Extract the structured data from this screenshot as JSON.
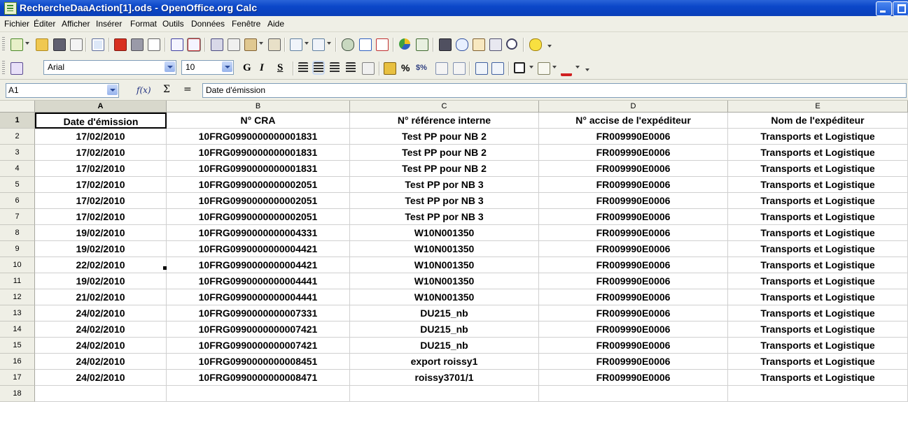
{
  "window": {
    "title": "RechercheDaaAction[1].ods - OpenOffice.org Calc"
  },
  "menu": [
    "Fichier",
    "Éditer",
    "Afficher",
    "Insérer",
    "Format",
    "Outils",
    "Données",
    "Fenêtre",
    "Aide"
  ],
  "format_toolbar": {
    "font_name": "Arial",
    "font_size": "10",
    "bold_label": "G",
    "italic_label": "I",
    "underline_label": "S",
    "percent_label": "%",
    "currency_label": "$%"
  },
  "formula_bar": {
    "cell_ref": "A1",
    "function_wizard": "f(x)",
    "sum_symbol": "Σ",
    "equals_symbol": "=",
    "content": "Date d'émission"
  },
  "sheet": {
    "columns": [
      "A",
      "B",
      "C",
      "D",
      "E"
    ],
    "headers": [
      "Date d'émission",
      "N° CRA",
      "N° référence interne",
      "N° accise de l'expéditeur",
      "Nom de l'expéditeur"
    ],
    "row_numbers": [
      "1",
      "2",
      "3",
      "4",
      "5",
      "6",
      "7",
      "8",
      "9",
      "10",
      "11",
      "12",
      "13",
      "14",
      "15",
      "16",
      "17",
      "18"
    ],
    "rows": [
      [
        "17/02/2010",
        "10FRG0990000000001831",
        "Test PP pour NB 2",
        "FR009990E0006",
        "Transports et Logistique"
      ],
      [
        "17/02/2010",
        "10FRG0990000000001831",
        "Test PP pour NB 2",
        "FR009990E0006",
        "Transports et Logistique"
      ],
      [
        "17/02/2010",
        "10FRG0990000000001831",
        "Test PP pour NB 2",
        "FR009990E0006",
        "Transports et Logistique"
      ],
      [
        "17/02/2010",
        "10FRG0990000000002051",
        "Test PP por NB 3",
        "FR009990E0006",
        "Transports et Logistique"
      ],
      [
        "17/02/2010",
        "10FRG0990000000002051",
        "Test PP por NB 3",
        "FR009990E0006",
        "Transports et Logistique"
      ],
      [
        "17/02/2010",
        "10FRG0990000000002051",
        "Test PP por NB 3",
        "FR009990E0006",
        "Transports et Logistique"
      ],
      [
        "19/02/2010",
        "10FRG0990000000004331",
        "W10N001350",
        "FR009990E0006",
        "Transports et Logistique"
      ],
      [
        "19/02/2010",
        "10FRG0990000000004421",
        "W10N001350",
        "FR009990E0006",
        "Transports et Logistique"
      ],
      [
        "22/02/2010",
        "10FRG0990000000004421",
        "W10N001350",
        "FR009990E0006",
        "Transports et Logistique"
      ],
      [
        "19/02/2010",
        "10FRG0990000000004441",
        "W10N001350",
        "FR009990E0006",
        "Transports et Logistique"
      ],
      [
        "21/02/2010",
        "10FRG0990000000004441",
        "W10N001350",
        "FR009990E0006",
        "Transports et Logistique"
      ],
      [
        "24/02/2010",
        "10FRG0990000000007331",
        "DU215_nb",
        "FR009990E0006",
        "Transports et Logistique"
      ],
      [
        "24/02/2010",
        "10FRG0990000000007421",
        "DU215_nb",
        "FR009990E0006",
        "Transports et Logistique"
      ],
      [
        "24/02/2010",
        "10FRG0990000000007421",
        "DU215_nb",
        "FR009990E0006",
        "Transports et Logistique"
      ],
      [
        "24/02/2010",
        "10FRG0990000000008451",
        "export roissy1",
        "FR009990E0006",
        "Transports et Logistique"
      ],
      [
        "24/02/2010",
        "10FRG0990000000008471",
        "roissy3701/1",
        "FR009990E0006",
        "Transports et Logistique"
      ]
    ]
  },
  "icons": {
    "standard": [
      "new-document-icon",
      "open-folder-icon",
      "save-icon",
      "email-icon",
      "edit-file-icon",
      "export-pdf-icon",
      "print-icon",
      "page-preview-icon",
      "spellcheck-icon",
      "autospellcheck-icon",
      "cut-icon",
      "copy-icon",
      "paste-icon",
      "format-paintbrush-icon",
      "undo-icon",
      "redo-icon",
      "hyperlink-icon",
      "sort-ascending-icon",
      "sort-descending-icon",
      "chart-icon",
      "show-draw-icon",
      "find-replace-icon",
      "navigator-icon",
      "gallery-icon",
      "data-sources-icon",
      "zoom-icon",
      "help-icon"
    ],
    "accent_colors": {
      "titlebar": "#0b47c9",
      "chrome": "#efefe6"
    }
  }
}
